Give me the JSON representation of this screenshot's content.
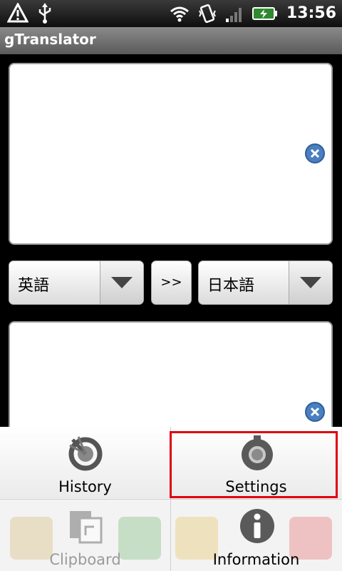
{
  "status_bar": {
    "time": "13:56",
    "icons": [
      "warning-icon",
      "usb-icon",
      "wifi-icon",
      "vibrate-icon",
      "signal-icon",
      "battery-charging-icon"
    ]
  },
  "app": {
    "title": "gTranslator"
  },
  "source_text": {
    "value": ""
  },
  "target_text": {
    "value": ""
  },
  "source_language": {
    "selected": "英語"
  },
  "target_language": {
    "selected": "日本語"
  },
  "swap_button": {
    "label": ">>"
  },
  "options_menu": {
    "items": [
      {
        "label": "History",
        "icon": "history-icon",
        "enabled": true
      },
      {
        "label": "Settings",
        "icon": "settings-gear-icon",
        "enabled": true,
        "highlighted": true
      },
      {
        "label": "Clipboard",
        "icon": "clipboard-icon",
        "enabled": false
      },
      {
        "label": "Information",
        "icon": "info-icon",
        "enabled": true
      }
    ]
  },
  "colors": {
    "highlight": "#e0000f",
    "clear_button": "#4a7fc0"
  }
}
